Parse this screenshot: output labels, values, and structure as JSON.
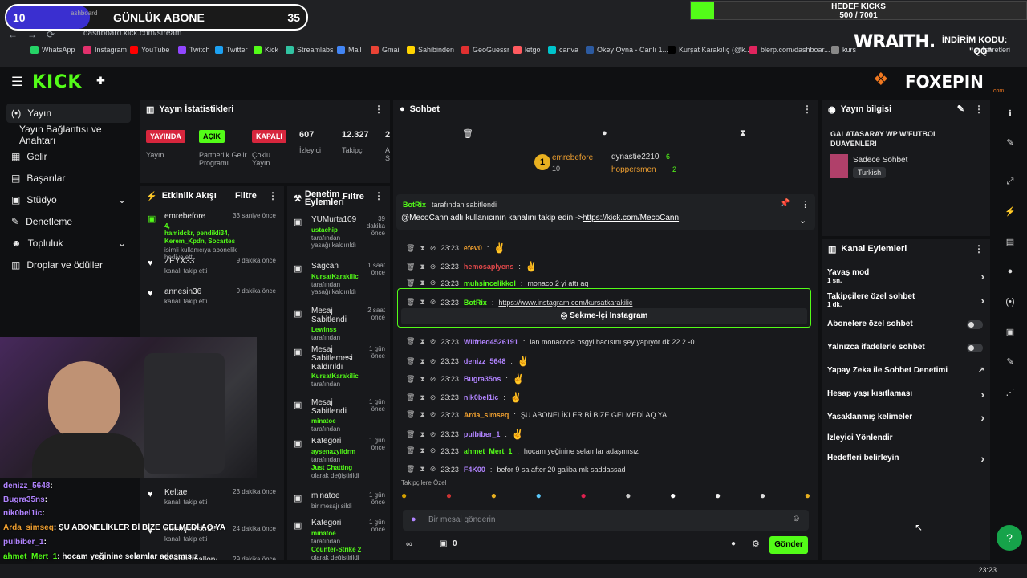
{
  "overlay": {
    "sub_goal_current": "10",
    "sub_goal_label": "GÜNLÜK ABONE",
    "sub_goal_target": "35",
    "kicks_title": "HEDEF KICKS",
    "kicks_value": "500 / 7001",
    "kicks_progress": 0.07,
    "wraith": "WRAITH.",
    "discount_label": "İNDİRİM KODU:",
    "discount_code": "\"QQ\"",
    "foxepin": "FOXEPIN",
    "foxepin_sub": ".com"
  },
  "browser": {
    "tab_fragment": "ashboard",
    "url": "dashboard.kick.com/stream",
    "bookmarks": [
      "WhatsApp",
      "Instagram",
      "YouTube",
      "Twitch",
      "Twitter",
      "Kick",
      "Streamlabs",
      "Mail",
      "Gmail",
      "Sahibinden",
      "GeoGuessr",
      "letgo",
      "canva",
      "Okey Oyna - Canlı 1...",
      "Kurşat Karakılıç (@k...",
      "blerp.com/dashboar...",
      "kurs"
    ],
    "bookmarks_other": "er İşaretleri"
  },
  "sidebar": {
    "items": [
      {
        "label": "Yayın",
        "icon": "broadcast-icon"
      },
      {
        "label": "Yayın Bağlantısı ve Anahtarı"
      },
      {
        "label": "Gelir",
        "icon": "revenue-icon"
      },
      {
        "label": "Başarılar",
        "icon": "achievements-icon"
      },
      {
        "label": "Stüdyo",
        "icon": "studio-icon"
      },
      {
        "label": "Denetleme",
        "icon": "wrench-icon"
      },
      {
        "label": "Topluluk",
        "icon": "community-icon"
      },
      {
        "label": "Droplar ve ödüller",
        "icon": "drops-icon"
      }
    ]
  },
  "stats": {
    "title": "Yayın İstatistikleri",
    "b1": "YAYINDA",
    "b2": "AÇIK",
    "b3": "KAPALI",
    "v1": "607",
    "v2": "12.327",
    "v3": "2",
    "l1": "Yayın",
    "l2": "Partnerlik Gelir Programı",
    "l3": "Çoklu Yayın",
    "l4": "İzleyici",
    "l5": "Takipçi",
    "l6": "A S"
  },
  "activity": {
    "title": "Etkinlik Akışı",
    "filter": "Filtre",
    "items": [
      {
        "name": "emrebefore",
        "time": "33 saniye önce",
        "extra": "4,",
        "extra2": "hamidckr, pendikli34, Kerem_Kpdn, Socartes",
        "desc": "isimli kullanıcıya abonelik hediye etti."
      },
      {
        "name": "ZEYX33",
        "time": "9 dakika önce",
        "desc": "kanalı takip etti"
      },
      {
        "name": "annesin36",
        "time": "9 dakika önce",
        "desc": "kanalı takip etti"
      },
      {
        "name": "Keltae",
        "time": "23 dakika önce",
        "desc": "kanalı takip etti"
      },
      {
        "name": "mertoparsko35",
        "time": "24 dakika önce",
        "desc": "kanalı takip etti"
      },
      {
        "name": "Everestmallory",
        "time": "29 dakika önce",
        "desc": "kanalı takip etti"
      }
    ]
  },
  "modlog": {
    "title": "Denetim Eylemleri",
    "filter": "Filtre",
    "items": [
      {
        "name": "YUMurta109",
        "time": "39 dakika önce",
        "who": "ustachip",
        "desc": "tarafından yasağı kaldırıldı"
      },
      {
        "name": "Sagcan",
        "time": "1 saat önce",
        "who": "KursatKarakilic",
        "desc": "tarafından yasağı kaldırıldı"
      },
      {
        "name": "Mesaj Sabitlendi",
        "time": "2 saat önce",
        "who": "Lewinss",
        "desc": "tarafından"
      },
      {
        "name": "Mesaj Sabitlemesi Kaldırıldı",
        "time": "1 gün önce",
        "who": "KursatKarakilic",
        "desc": "tarafından"
      },
      {
        "name": "Mesaj Sabitlendi",
        "time": "1 gün önce",
        "who": "minatoe",
        "desc": "tarafından"
      },
      {
        "name": "Kategori",
        "time": "1 gün önce",
        "who": "aysenazyildrm",
        "desc": "tarafından",
        "who2": "Just Chatting",
        "desc2": "olarak değiştirildi"
      },
      {
        "name": "minatoe",
        "time": "1 gün önce",
        "desc": "bir mesajı sildi"
      },
      {
        "name": "Kategori",
        "time": "1 gün önce",
        "who": "minatoe",
        "desc": "tarafından",
        "who2": "Counter-Strike 2",
        "desc2": "olarak değiştirildi"
      }
    ]
  },
  "chat": {
    "title": "Sohbet",
    "top1_rank": "1",
    "top1_name": "emrebefore",
    "top1_count": "10",
    "top2_name": "dynastie2210",
    "top2_count": "6",
    "top3_name": "hoppersmen",
    "top3_count": "2",
    "pinned_by": "BotRix",
    "pinned_label": "tarafından sabitlendi",
    "pinned_msg": "@MecoCann adlı kullanıcının kanalını takip edin ->",
    "pinned_link": "https://kick.com/MecoCann",
    "messages": [
      {
        "time": "23:23",
        "user": "efev0",
        "color": "#f0a030",
        "text": "",
        "emote": true
      },
      {
        "time": "23:23",
        "user": "hemosaplyens",
        "color": "#e0484a",
        "text": "",
        "emote": true
      },
      {
        "time": "23:23",
        "user": "muhsincelikkol",
        "color": "#53fc18",
        "text": "monaco 2 yi attı aq"
      },
      {
        "time": "23:23",
        "user": "BotRix",
        "color": "#53fc18",
        "text": "https://www.instagram.com/kursatkarakilic",
        "bot": true
      },
      {
        "time": "23:23",
        "user": "Wilfried4526191",
        "color": "#b184ff",
        "text": "lan monacoda psgyi bacısını şey yapıyor dk 22 2 -0"
      },
      {
        "time": "23:23",
        "user": "denizz_5648",
        "color": "#b184ff",
        "text": "",
        "emote": true
      },
      {
        "time": "23:23",
        "user": "Bugra35ns",
        "color": "#b184ff",
        "text": "",
        "emote": true
      },
      {
        "time": "23:23",
        "user": "nik0bel1ic",
        "color": "#b184ff",
        "text": "",
        "emote": true
      },
      {
        "time": "23:23",
        "user": "Arda_simseq",
        "color": "#f0a030",
        "text": "ŞU ABONELİKLER Bİ BİZE GELMEDİ AQ YA"
      },
      {
        "time": "23:23",
        "user": "pulbiber_1",
        "color": "#b184ff",
        "text": "",
        "emote": true
      },
      {
        "time": "23:23",
        "user": "ahmet_Mert_1",
        "color": "#53fc18",
        "text": "hocam yeğinine selamlar adaşmısız"
      },
      {
        "time": "23:23",
        "user": "F4K00",
        "color": "#b184ff",
        "text": "befor 9 sa after 20 galiba mk saddassad"
      }
    ],
    "insta_button": "Sekme-İçi Instagram",
    "followers_label": "Takipçilere Özel",
    "placeholder": "Bir mesaj gönderin",
    "points": "0",
    "send": "Gönder"
  },
  "info": {
    "title": "Yayın bilgisi",
    "stream_title": "GALATASARAY WP W/FUTBOL DUAYENLERİ",
    "category": "Sadece Sohbet",
    "language": "Turkish"
  },
  "channel": {
    "title": "Kanal Eylemleri",
    "items": [
      {
        "label": "Yavaş mod",
        "sub": "1 sn.",
        "type": "chevron"
      },
      {
        "label": "Takipçilere özel sohbet",
        "sub": "1 dk.",
        "type": "chevron"
      },
      {
        "label": "Abonelere özel sohbet",
        "type": "toggle"
      },
      {
        "label": "Yalnızca ifadelerle sohbet",
        "type": "toggle"
      },
      {
        "label": "Yapay Zeka ile Sohbet Denetimi",
        "type": "external"
      },
      {
        "label": "Hesap yaşı kısıtlaması",
        "type": "chevron"
      },
      {
        "label": "Yasaklanmış kelimeler",
        "type": "chevron"
      },
      {
        "label": "İzleyici Yönlendir",
        "type": "none"
      },
      {
        "label": "Hedefleri belirleyin",
        "type": "chevron"
      }
    ]
  },
  "overlay_chat": [
    {
      "user": "denizz_5648",
      "color": "#b184ff",
      "text": ":"
    },
    {
      "user": "Bugra35ns",
      "color": "#b184ff",
      "text": ":"
    },
    {
      "user": "nik0bel1ic",
      "color": "#b184ff",
      "text": ":"
    },
    {
      "user": "Arda_simseq",
      "color": "#f0a030",
      "text": ": ŞU ABONELİKLER Bİ BİZE GELMEDİ AQ YA"
    },
    {
      "user": "pulbiber_1",
      "color": "#b184ff",
      "text": ":"
    },
    {
      "user": "ahmet_Mert_1",
      "color": "#53fc18",
      "text": ": hocam yeğinine selamlar adaşmısız"
    },
    {
      "user": "",
      "color": "#fff",
      "text": "0 befor 9 sa after 20 galiba mk saddassad"
    }
  ],
  "taskbar": {
    "time": "23:23"
  }
}
